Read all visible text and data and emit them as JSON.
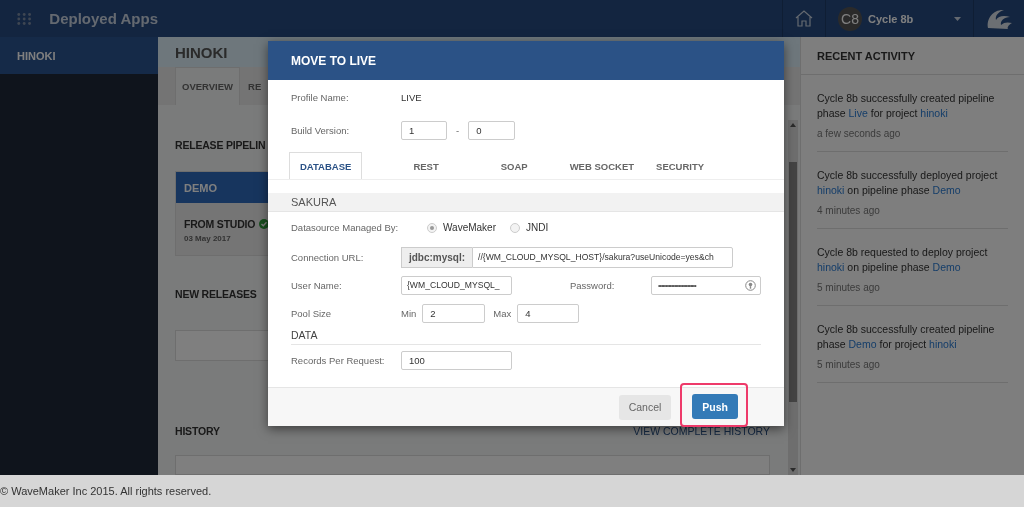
{
  "topbar": {
    "title": "Deployed Apps",
    "user_initials": "C8",
    "user_name": "Cycle 8b"
  },
  "sidebar": {
    "items": [
      {
        "label": "HINOKI",
        "selected": true
      }
    ]
  },
  "main": {
    "title": "HINOKI",
    "tabs": [
      {
        "label": "OVERVIEW",
        "selected": true
      },
      {
        "label": "RE",
        "selected": false
      }
    ],
    "pipeline": {
      "heading": "RELEASE PIPELIN",
      "phase": "DEMO",
      "source": "FROM STUDIO",
      "date": "03 May 2017",
      "success": true
    },
    "new_releases": {
      "heading": "NEW RELEASES"
    },
    "history": {
      "heading": "HISTORY",
      "link": "VIEW COMPLETE HISTORY"
    }
  },
  "recent_activity": {
    "heading": "RECENT ACTIVITY",
    "items": [
      {
        "parts": [
          {
            "text": "Cycle 8b successfully created pipeline phase ",
            "link": false
          },
          {
            "text": "Live",
            "link": true
          },
          {
            "text": " for project ",
            "link": false
          },
          {
            "text": "hinoki",
            "link": true
          }
        ],
        "time": "a few seconds ago"
      },
      {
        "parts": [
          {
            "text": "Cycle 8b successfully deployed project ",
            "link": false
          },
          {
            "text": "hinoki",
            "link": true
          },
          {
            "text": " on pipeline phase ",
            "link": false
          },
          {
            "text": "Demo",
            "link": true
          }
        ],
        "time": "4 minutes ago"
      },
      {
        "parts": [
          {
            "text": "Cycle 8b requested to deploy project ",
            "link": false
          },
          {
            "text": "hinoki",
            "link": true
          },
          {
            "text": " on pipeline phase ",
            "link": false
          },
          {
            "text": "Demo",
            "link": true
          }
        ],
        "time": "5 minutes ago"
      },
      {
        "parts": [
          {
            "text": "Cycle 8b successfully created pipeline phase ",
            "link": false
          },
          {
            "text": "Demo",
            "link": true
          },
          {
            "text": " for project ",
            "link": false
          },
          {
            "text": "hinoki",
            "link": true
          }
        ],
        "time": "5 minutes ago"
      }
    ]
  },
  "dialog": {
    "title": "MOVE TO LIVE",
    "profile_label": "Profile Name:",
    "profile_value": "LIVE",
    "build_label": "Build Version:",
    "build_major": "1",
    "build_separator": "-",
    "build_minor": "0",
    "tabs": [
      {
        "label": "DATABASE",
        "selected": true
      },
      {
        "label": "REST",
        "selected": false
      },
      {
        "label": "SOAP",
        "selected": false
      },
      {
        "label": "WEB SOCKET",
        "selected": false
      },
      {
        "label": "SECURITY",
        "selected": false
      }
    ],
    "section": "SAKURA",
    "datasource_label": "Datasource Managed By:",
    "datasource_options": [
      {
        "label": "WaveMaker",
        "selected": true
      },
      {
        "label": "JNDI",
        "selected": false
      }
    ],
    "url_label": "Connection URL:",
    "url_prefix": "jdbc:mysql:",
    "url_value": "//{WM_CLOUD_MYSQL_HOST}/sakura?useUnicode=yes&ch",
    "user_label": "User Name:",
    "user_value": "{WM_CLOUD_MYSQL_",
    "password_label": "Password:",
    "password_value": "••••••••••••••••••••••••••",
    "pool_label": "Pool Size",
    "min_label": "Min",
    "min_value": "2",
    "max_label": "Max",
    "max_value": "4",
    "data_heading": "DATA",
    "records_label": "Records Per Request:",
    "records_value": "100",
    "buttons": [
      {
        "label": "Cancel",
        "kind": "secondary",
        "highlighted": false
      },
      {
        "label": "Push",
        "kind": "primary",
        "highlighted": true
      }
    ]
  },
  "footer": "© WaveMaker Inc 2015. All rights reserved."
}
